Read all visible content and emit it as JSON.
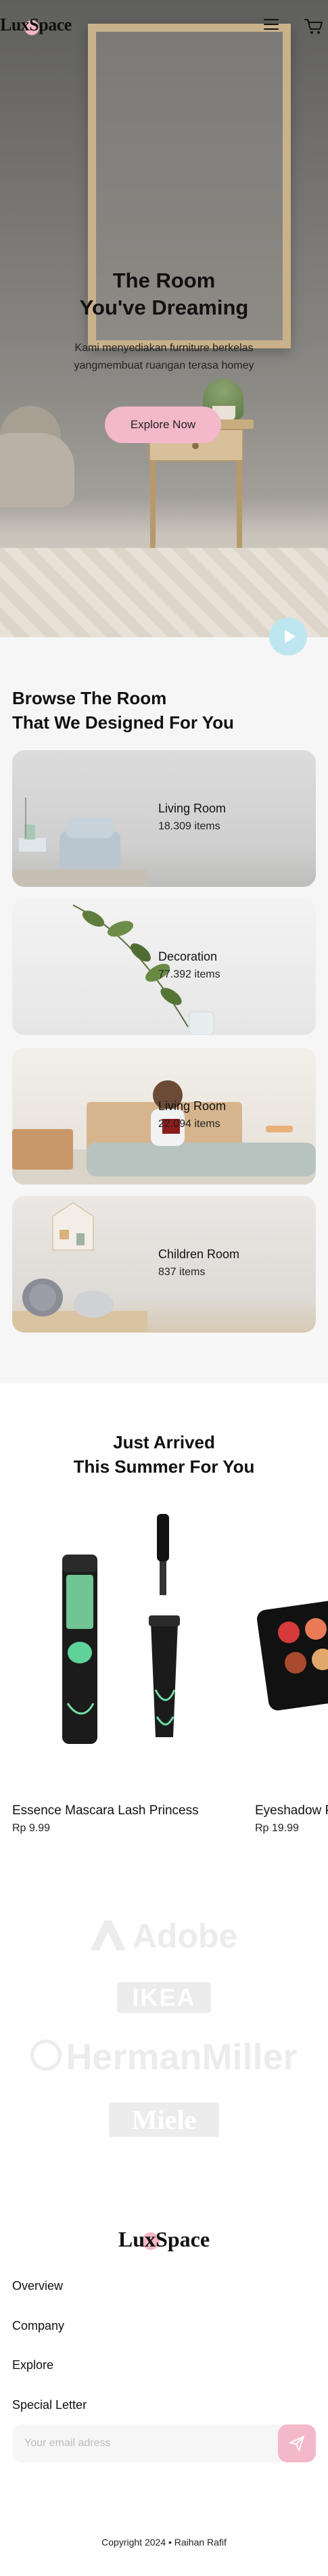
{
  "brand": {
    "name": "LuxSpace"
  },
  "header": {
    "menu_icon": "hamburger-menu-icon",
    "cart_icon": "shopping-cart-icon"
  },
  "hero": {
    "title_line1": "The Room",
    "title_line2": "You've Dreaming",
    "subtitle_line1": "Kami menyediakan furniture berkelas",
    "subtitle_line2": "yangmembuat ruangan terasa homey",
    "cta_label": "Explore Now",
    "play_icon": "play-icon"
  },
  "browse": {
    "title_line1": "Browse The Room",
    "title_line2": "That We Designed For You",
    "rooms": [
      {
        "name": "Living Room",
        "count": "18.309 items"
      },
      {
        "name": "Decoration",
        "count": "77.392 items"
      },
      {
        "name": "Living Room",
        "count": "22.094 items"
      },
      {
        "name": "Children Room",
        "count": "837 items"
      }
    ]
  },
  "arrived": {
    "title_line1": "Just Arrived",
    "title_line2": "This Summer For You",
    "products": [
      {
        "name": "Essence Mascara Lash Princess",
        "price": "Rp 9.99"
      },
      {
        "name": "Eyeshadow Palette with Mirror",
        "price": "Rp 19.99"
      }
    ]
  },
  "partners": [
    "Adobe",
    "IKEA",
    "HermanMiller",
    "Miele"
  ],
  "footer": {
    "links": [
      "Overview",
      "Company",
      "Explore",
      "Special Letter"
    ],
    "email_placeholder": "Your email adress",
    "send_icon": "paper-plane-icon",
    "copyright": "Copyright 2024 • Raihan Rafif"
  },
  "colors": {
    "accent_pink": "#f4b8cb",
    "play_blue": "#bde6f1",
    "card_bg": "#f6f6f7"
  }
}
